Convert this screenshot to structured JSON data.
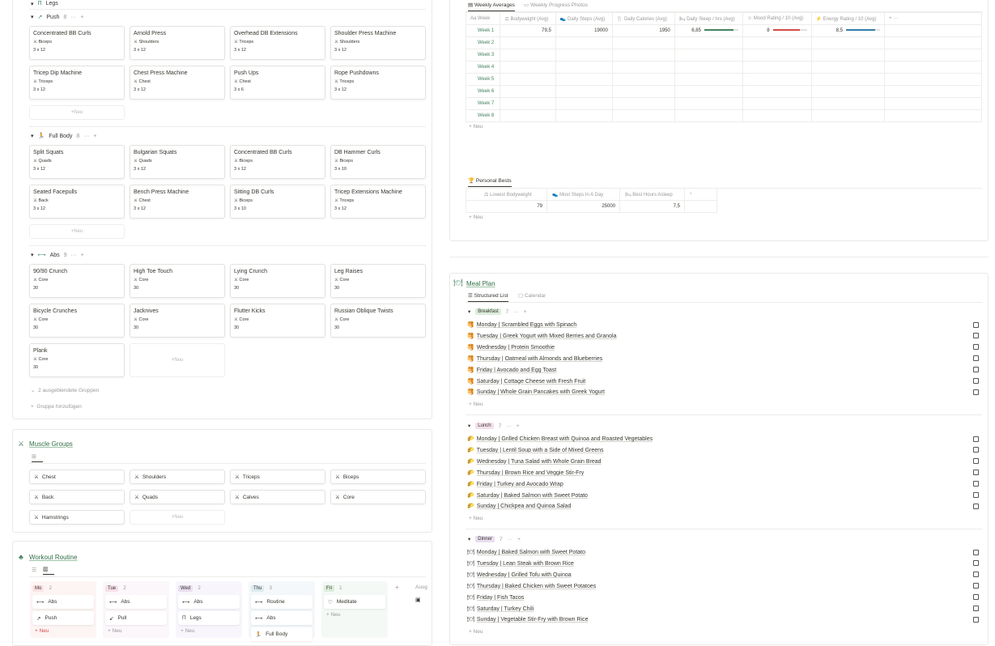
{
  "exercises": {
    "prev_group": {
      "label": "Legs"
    },
    "groups": [
      {
        "name": "Push",
        "count": "8",
        "icon": "↗",
        "cards": [
          {
            "title": "Concentrated BB Curls",
            "tag": "Biceps",
            "sets": "3 x 12"
          },
          {
            "title": "Arnold Press",
            "tag": "Shoulders",
            "sets": "3 x 12"
          },
          {
            "title": "Overhead DB Extensions",
            "tag": "Triceps",
            "sets": "3 x 12"
          },
          {
            "title": "Shoulder Press Machine",
            "tag": "Shoulders",
            "sets": "3 x 12"
          },
          {
            "title": "Tricep Dip Machine",
            "tag": "Triceps",
            "sets": "3 x 12"
          },
          {
            "title": "Chest Press Machine",
            "tag": "Chest",
            "sets": "3 x 12"
          },
          {
            "title": "Push Ups",
            "tag": "Chest",
            "sets": "3 x 6"
          },
          {
            "title": "Rope Pushdowns",
            "tag": "Triceps",
            "sets": "3 x 12"
          }
        ]
      },
      {
        "name": "Full Body",
        "count": "8",
        "icon": "🏃",
        "cards": [
          {
            "title": "Split Squats",
            "tag": "Quads",
            "sets": "3 x 12"
          },
          {
            "title": "Bulgarian Squats",
            "tag": "Quads",
            "sets": "3 x 12"
          },
          {
            "title": "Concentrated BB Curls",
            "tag": "Biceps",
            "sets": "3 x 12"
          },
          {
            "title": "DB Hammer Curls",
            "tag": "Biceps",
            "sets": "3 x 10"
          },
          {
            "title": "Seated Facepulls",
            "tag": "Back",
            "sets": "3 x 12"
          },
          {
            "title": "Bench Press Machine",
            "tag": "Chest",
            "sets": "3 x 12"
          },
          {
            "title": "Sitting DB Curls",
            "tag": "Biceps",
            "sets": "3 x 10"
          },
          {
            "title": "Tricep Extensions Machine",
            "tag": "Triceps",
            "sets": "3 x 12"
          }
        ]
      },
      {
        "name": "Abs",
        "count": "9",
        "icon": "⟷",
        "cards": [
          {
            "title": "90/90 Crunch",
            "tag": "Core",
            "sets": "30"
          },
          {
            "title": "High Toe Touch",
            "tag": "Core",
            "sets": "30"
          },
          {
            "title": "Lying Crunch",
            "tag": "Core",
            "sets": "30"
          },
          {
            "title": "Leg Raises",
            "tag": "Core",
            "sets": "30"
          },
          {
            "title": "Bicycle Crunches",
            "tag": "Core",
            "sets": "30"
          },
          {
            "title": "Jacknives",
            "tag": "Core",
            "sets": "30"
          },
          {
            "title": "Flutter Kicks",
            "tag": "Core",
            "sets": "30"
          },
          {
            "title": "Russian Oblique Twists",
            "tag": "Core",
            "sets": "30"
          },
          {
            "title": "Plank",
            "tag": "Core",
            "sets": "30"
          }
        ]
      }
    ],
    "new_label": "Neu",
    "hidden_groups": "2 ausgeblendete Gruppen",
    "add_group": "Gruppe hinzufügen"
  },
  "muscle_groups": {
    "title": "Muscle Groups",
    "items": [
      "Chest",
      "Shoulders",
      "Triceps",
      "Biceps",
      "Back",
      "Quads",
      "Calves",
      "Core",
      "Hamstrings"
    ],
    "new_label": "Neu"
  },
  "workout_routine": {
    "title": "Workout Routine",
    "hidden_label": "Ausg",
    "columns": [
      {
        "day": "Mo",
        "count": "2",
        "bg": "#fdf5f4",
        "pill": "#fbe4e4",
        "items": [
          {
            "icon": "⟷",
            "label": "Abs"
          },
          {
            "icon": "↗",
            "label": "Push"
          }
        ],
        "new": "Neu"
      },
      {
        "day": "Tue",
        "count": "2",
        "bg": "#fbf7fb",
        "pill": "#f5e0e9",
        "items": [
          {
            "icon": "⟷",
            "label": "Abs"
          },
          {
            "icon": "↙",
            "label": "Pull"
          }
        ],
        "new": "Neu"
      },
      {
        "day": "Wed",
        "count": "2",
        "bg": "#f8f6fc",
        "pill": "#e8deee",
        "items": [
          {
            "icon": "⟷",
            "label": "Abs"
          },
          {
            "icon": "Π",
            "label": "Legs"
          }
        ],
        "new": "Neu"
      },
      {
        "day": "Thu",
        "count": "3",
        "bg": "#f4f8fb",
        "pill": "#ddebf1",
        "items": [
          {
            "icon": "⟷",
            "label": "Routine"
          },
          {
            "icon": "⟷",
            "label": "Abs"
          },
          {
            "icon": "🏃",
            "label": "Full Body"
          }
        ],
        "new": ""
      },
      {
        "day": "Fri",
        "count": "1",
        "bg": "#f5f9f6",
        "pill": "#dbeddb",
        "items": [
          {
            "icon": "♡",
            "label": "Meditate"
          }
        ],
        "new": "Neu"
      }
    ]
  },
  "weekly": {
    "tabs": [
      "Weekly Averages",
      "Weekly Progress Photos"
    ],
    "columns": [
      "Week",
      "Bodyweight (Avg)",
      "Daily Steps (Avg)",
      "Daily Calories (Avg)",
      "Daily Sleep / hrs (Avg)",
      "Mood Rating / 10 (Avg)",
      "Energy Rating / 10 (Avg)"
    ],
    "rows": [
      {
        "week": "Week 1",
        "bodyweight": "79,5",
        "steps": "19000",
        "calories": "1950",
        "sleep": "6,85",
        "mood": "8",
        "energy": "8,5"
      },
      {
        "week": "Week 2"
      },
      {
        "week": "Week 3"
      },
      {
        "week": "Week 4"
      },
      {
        "week": "Week 5"
      },
      {
        "week": "Week 6"
      },
      {
        "week": "Week 7"
      },
      {
        "week": "Week 8"
      }
    ],
    "progress": {
      "sleep": 0.85,
      "mood": 0.8,
      "energy": 0.85
    },
    "colors": {
      "sleep": "#448361",
      "mood": "#d44c47",
      "energy": "#337ea9"
    },
    "new_label": "Neu"
  },
  "personal_bests": {
    "title": "Personal Bests",
    "columns": [
      "Lowest Bodyweight",
      "Most Steps In A Day",
      "Best Hours Asleep"
    ],
    "values": [
      "79",
      "25000",
      "7,5"
    ],
    "new_label": "Neu"
  },
  "meal_plan": {
    "title": "Meal Plan",
    "tabs": [
      "Structured List",
      "Calendar"
    ],
    "groups": [
      {
        "name": "Breakfast",
        "count": "7",
        "icon": "🥞",
        "pill": "#dbeddb",
        "items": [
          "Monday | Scrambled Eggs with Spinach",
          "Tuesday | Greek Yogurt with Mixed Berries and Granola",
          "Wednesday | Protein Smoothie",
          "Thursday | Oatmeal with Almonds and Blueberries",
          "Friday | Avocado and Egg Toast",
          "Saturday | Cottage Cheese with Fresh Fruit",
          "Sunday | Whole Grain Pancakes with Greek Yogurt"
        ]
      },
      {
        "name": "Lunch",
        "count": "7",
        "icon": "🌮",
        "pill": "#f4dfeb",
        "items": [
          "Monday | Grilled Chicken Breast with Quinoa and Roasted Vegetables",
          "Tuesday | Lentil Soup with a Side of Mixed Greens",
          "Wednesday | Tuna Salad with Whole Grain Bread",
          "Thursday | Brown Rice and Veggie Stir-Fry",
          "Friday | Turkey and Avocado Wrap",
          "Saturday | Baked Salmon with Sweet Potato",
          "Sunday | Chickpea and Quinoa Salad"
        ]
      },
      {
        "name": "Dinner",
        "count": "7",
        "icon": "🍽",
        "pill": "#e8deee",
        "items": [
          "Monday | Baked Salmon with Sweet Potato",
          "Tuesday | Lean Steak with Brown Rice",
          "Wednesday | Grilled Tofu with Quinoa",
          "Thursday | Baked Chicken with Sweet Potatoes",
          "Friday | Fish Tacos",
          "Saturday | Turkey Chili",
          "Sunday | Vegetable Stir-Fry with Brown Rice"
        ]
      }
    ],
    "new_label": "Neu"
  }
}
